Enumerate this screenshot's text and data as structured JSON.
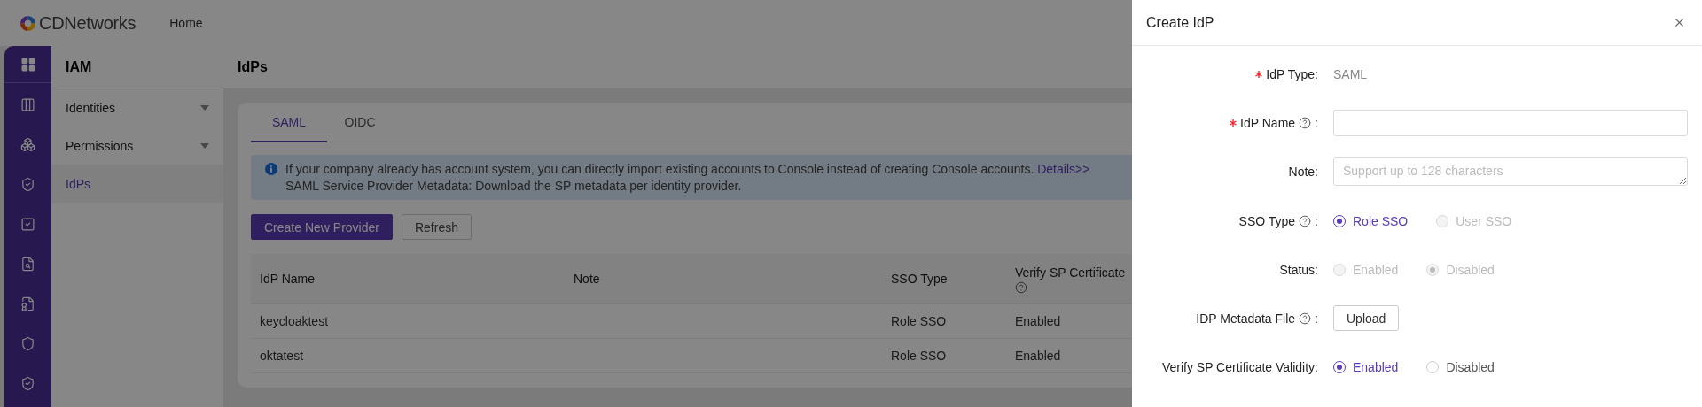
{
  "header": {
    "logo_text": "CDNetworks",
    "nav": [
      {
        "label": "Home"
      }
    ]
  },
  "sidebar": {
    "title": "IAM",
    "items": [
      {
        "label": "Identities",
        "kind": "group",
        "selected": false
      },
      {
        "label": "Permissions",
        "kind": "group",
        "selected": false
      },
      {
        "label": "IdPs",
        "kind": "link",
        "selected": true
      }
    ]
  },
  "page": {
    "title": "IdPs"
  },
  "tabs": [
    {
      "label": "SAML",
      "selected": true
    },
    {
      "label": "OIDC",
      "selected": false
    }
  ],
  "alert": {
    "line_1": "If your company already has account system, you can directly import existing accounts to Console instead of creating Console accounts.",
    "link": "Details>>",
    "line_2": "SAML Service Provider Metadata: Download the SP metadata per identity provider."
  },
  "buttons": [
    {
      "label": "Create New Provider",
      "kind": "primary"
    },
    {
      "label": "Refresh",
      "kind": "default"
    }
  ],
  "table": {
    "columns": [
      {
        "label": "IdP Name",
        "help": false
      },
      {
        "label": "Note",
        "help": false
      },
      {
        "label": "SSO Type",
        "help": false
      },
      {
        "label": "Verify SP Certificate",
        "help": true
      }
    ],
    "rows": [
      {
        "idp_name": "keycloaktest",
        "sso_type": "Role SSO",
        "verify_sp_certificate": "Enabled"
      },
      {
        "idp_name": "oktatest",
        "sso_type": "Role SSO",
        "verify_sp_certificate": "Enabled"
      }
    ]
  },
  "drawer": {
    "title": "Create IdP",
    "fields": [
      {
        "kind": "text",
        "label": "IdP Type:",
        "required": true,
        "help": false,
        "value": "SAML"
      },
      {
        "kind": "input",
        "label": "IdP Name",
        "required": true,
        "help": true,
        "after_help": ":"
      },
      {
        "kind": "textarea",
        "label": "Note:",
        "required": false,
        "help": false,
        "placeholder": "Support up to 128 characters"
      },
      {
        "kind": "radio",
        "label": "SSO Type",
        "required": false,
        "help": true,
        "after_help": ":",
        "options": [
          {
            "label": "Role SSO",
            "selected": true,
            "disabled": false
          },
          {
            "label": "User SSO",
            "selected": false,
            "disabled": true
          }
        ]
      },
      {
        "kind": "radio",
        "label": "Status:",
        "required": false,
        "help": false,
        "options": [
          {
            "label": "Enabled",
            "selected": false,
            "disabled": true
          },
          {
            "label": "Disabled",
            "selected": true,
            "disabled": true
          }
        ]
      },
      {
        "kind": "upload",
        "label": "IDP Metadata File",
        "required": false,
        "help": true,
        "after_help": ":",
        "button": "Upload"
      },
      {
        "kind": "radio",
        "label": "Verify SP Certificate Validity:",
        "required": false,
        "help": false,
        "options": [
          {
            "label": "Enabled",
            "selected": true,
            "disabled": false
          },
          {
            "label": "Disabled",
            "selected": false,
            "disabled": false
          }
        ]
      }
    ]
  }
}
